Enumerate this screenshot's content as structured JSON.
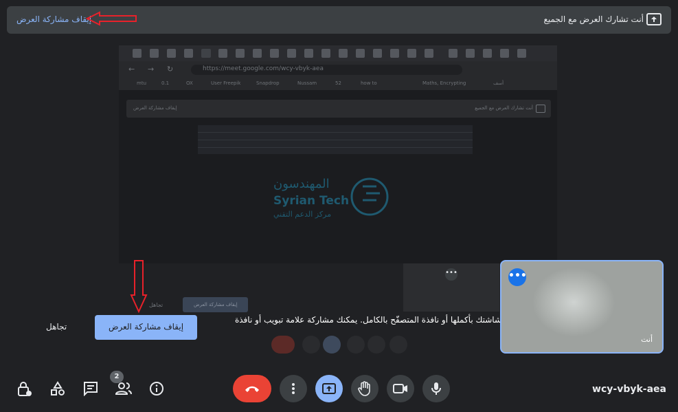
{
  "top_bar": {
    "stop_link": "إيقاف مشاركة العرض",
    "status": "أنت تشارك العرض مع الجميع",
    "icon": "present-to-all-icon"
  },
  "shared_screen": {
    "address": "https://meet.google.com/wcy-vbyk-aea",
    "bookmarks": [
      "mtu",
      "0.1",
      "OX",
      "User Freepik",
      "Snapdrop",
      "Nussam",
      "52",
      "how to",
      "Maths, Encrypting",
      "أسف"
    ],
    "inner_status": "أنت تشارك العرض مع الجميع",
    "inner_stop": "إيقاف مشاركة العرض",
    "logo_line1": "المهندسون",
    "logo_line2": "Syrian Tech",
    "logo_line3": "مركز الدعم التقني",
    "inner_ignore": "تجاهل",
    "inner_hint": "شاشتك بأكملها أو نافذة المتصفّح بالكامل. يمكنك مشاركة علامة تبويب أو نافذة"
  },
  "share_hint": {
    "text": "شاشتك بأكملها أو نافذة المتصفّح بالكامل. يمكنك مشاركة علامة تبويب أو نافذة",
    "ignore_label": "تجاهل",
    "stop_label": "إيقاف مشاركة العرض"
  },
  "self_tile": {
    "name": "أنت",
    "menu_icon": "more-horiz-icon"
  },
  "controls": {
    "participants_count": "2",
    "meeting_code": "wcy-vbyk-aea",
    "left_icons": [
      "lock-person-icon",
      "activities-icon",
      "chat-icon",
      "people-icon",
      "info-icon"
    ],
    "center_icons": [
      "call-end-icon",
      "more-vert-icon",
      "present-icon",
      "raise-hand-icon",
      "camera-icon",
      "mic-icon"
    ],
    "end_call_color": "#ea4335",
    "present_color": "#8ab4f8"
  },
  "colors": {
    "background": "#202124",
    "accent": "#8ab4f8",
    "self_tile_border": "#8ab4f8"
  }
}
